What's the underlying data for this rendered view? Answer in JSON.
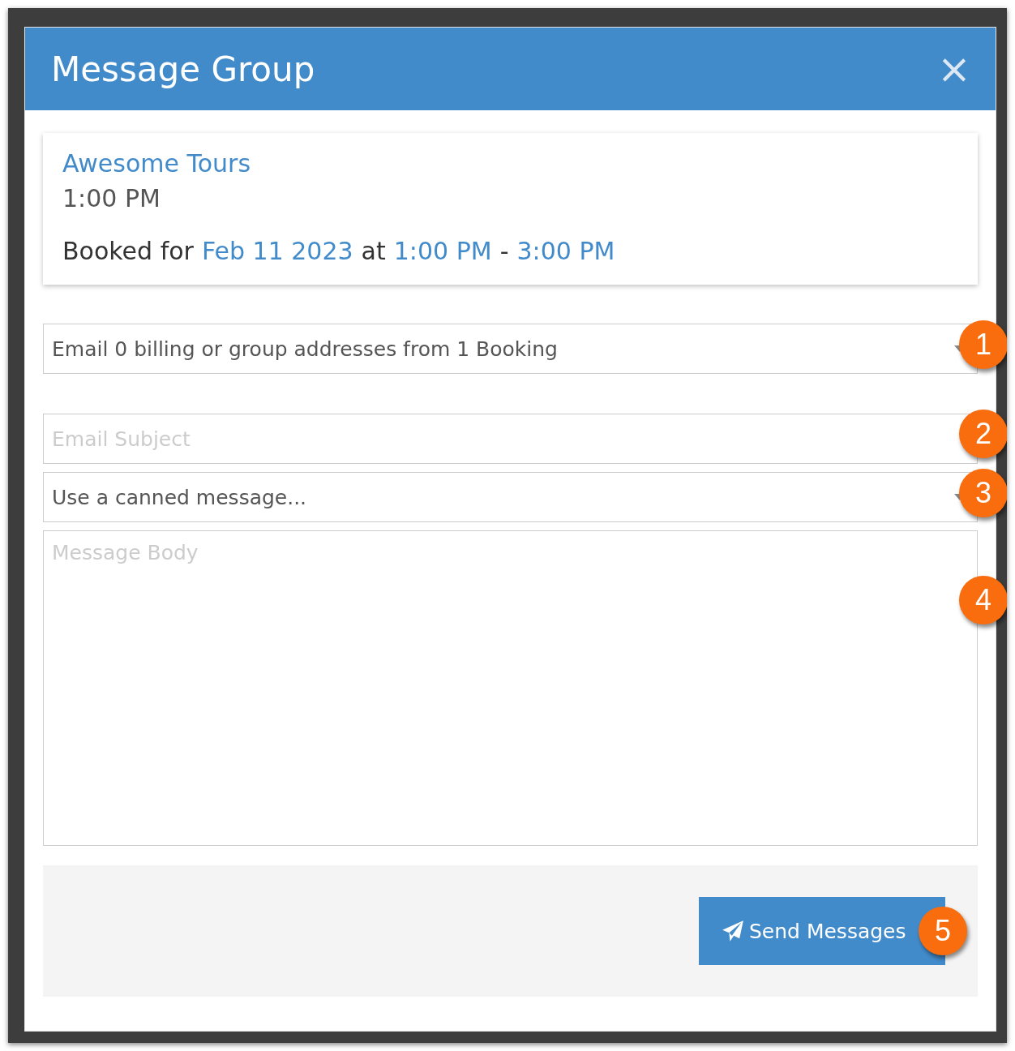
{
  "dialog": {
    "title": "Message Group",
    "close": "×"
  },
  "booking": {
    "name": "Awesome Tours",
    "time": "1:00 PM",
    "booked_for": "Booked for",
    "date": "Feb 11 2023",
    "at": "at",
    "start": "1:00 PM",
    "dash": "-",
    "end": "3:00 PM"
  },
  "recipients": {
    "value": "Email 0 billing or group addresses from 1 Booking",
    "callout": "1"
  },
  "subject": {
    "placeholder": "Email Subject",
    "callout": "2"
  },
  "canned": {
    "value": "Use a canned message...",
    "callout": "3"
  },
  "body": {
    "placeholder": "Message Body",
    "callout": "4"
  },
  "send_button": {
    "label": "Send Messages",
    "callout": "5"
  }
}
